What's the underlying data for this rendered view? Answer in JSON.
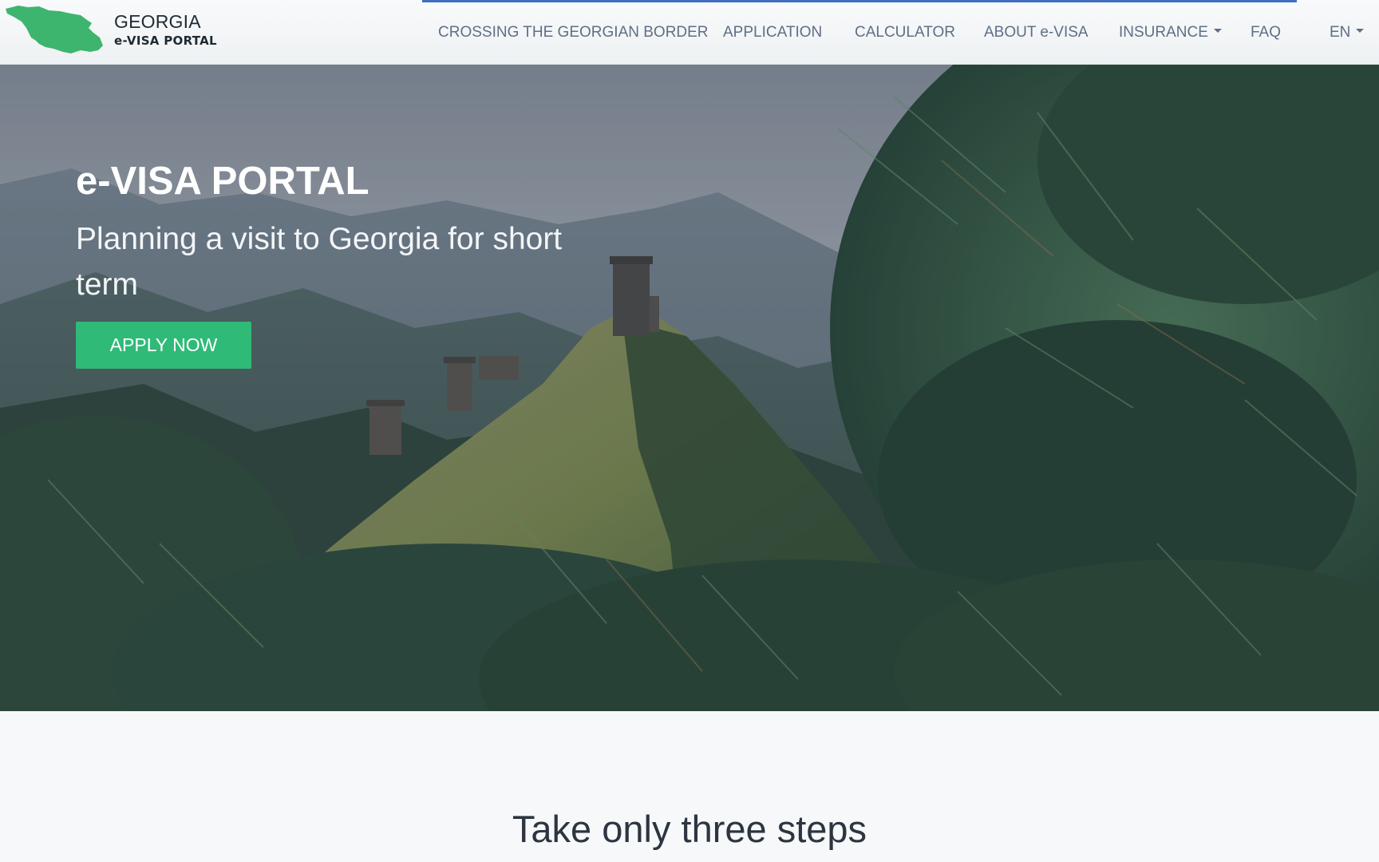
{
  "brand": {
    "line1": "GEORGIA",
    "line2": "e-VISA PORTAL",
    "logo_icon": "georgia-map-icon",
    "map_color": "#3db56e"
  },
  "nav": {
    "accent_color": "#3f6fbf",
    "items": [
      {
        "label": "CROSSING THE GEORGIAN BORDER"
      },
      {
        "label": "APPLICATION"
      },
      {
        "label": "CALCULATOR"
      },
      {
        "label": "ABOUT e-VISA"
      },
      {
        "label": "INSURANCE",
        "dropdown": true
      },
      {
        "label": "FAQ"
      }
    ],
    "language": {
      "label": "EN",
      "dropdown": true
    }
  },
  "hero": {
    "title": "e-VISA PORTAL",
    "subtitle": "Planning a visit to Georgia for short term",
    "cta_label": "APPLY NOW",
    "cta_color": "#2fba78",
    "background": "mountain-towers-pine-landscape"
  },
  "steps": {
    "title": "Take only three steps"
  }
}
